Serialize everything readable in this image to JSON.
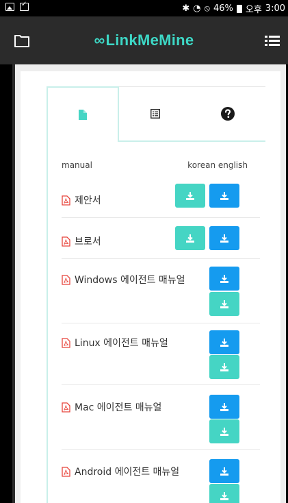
{
  "status_bar": {
    "battery": "46%",
    "ampm": "오후",
    "time": "3:00"
  },
  "app": {
    "logo_text": "LinkMeMine"
  },
  "tabs": [
    {
      "name": "document",
      "active": true
    },
    {
      "name": "list",
      "active": false
    },
    {
      "name": "help",
      "active": false
    }
  ],
  "list_header": {
    "left": "manual",
    "right": "korean english"
  },
  "manuals": [
    {
      "label": "제안서"
    },
    {
      "label": "브로서"
    },
    {
      "label": "Windows 에이전트 매뉴얼"
    },
    {
      "label": "Linux 에이전트 매뉴얼"
    },
    {
      "label": "Mac 에이전트 매뉴얼"
    },
    {
      "label": "Android 에이전트 매뉴얼"
    }
  ],
  "colors": {
    "teal": "#45d5c4",
    "blue": "#159bef",
    "pdf_red": "#e8453c",
    "appbar": "#2b2b2b"
  }
}
